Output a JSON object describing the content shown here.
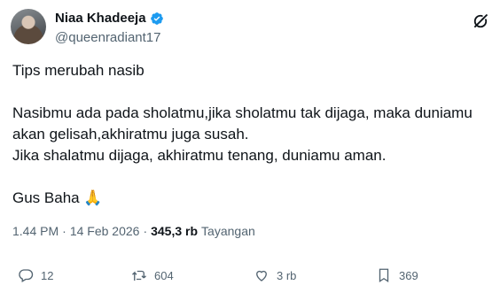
{
  "author": {
    "display_name": "Niaa Khadeeja",
    "handle": "@queenradiant17",
    "verified": true
  },
  "post": {
    "line1": "Tips merubah nasib",
    "line2": "Nasibmu ada pada sholatmu,jika sholatmu tak dijaga, maka duniamu",
    "line3": "akan gelisah,akhiratmu juga susah.",
    "line4": "Jika shalatmu dijaga, akhiratmu tenang, duniamu aman.",
    "signature": "Gus Baha",
    "emoji": "🙏"
  },
  "meta": {
    "time": "1.44 PM",
    "separator1": "·",
    "date": "14 Feb 2026",
    "separator2": "·",
    "views": "345,3 rb",
    "views_label": "Tayangan"
  },
  "actions": {
    "replies": "12",
    "reposts": "604",
    "likes": "3 rb",
    "bookmarks": "369"
  },
  "colors": {
    "text": "#0f1419",
    "secondary": "#536471",
    "verified": "#1d9bf0"
  },
  "icons": [
    "verified-badge-icon",
    "grok-icon",
    "reply-icon",
    "repost-icon",
    "like-icon",
    "bookmark-icon"
  ]
}
